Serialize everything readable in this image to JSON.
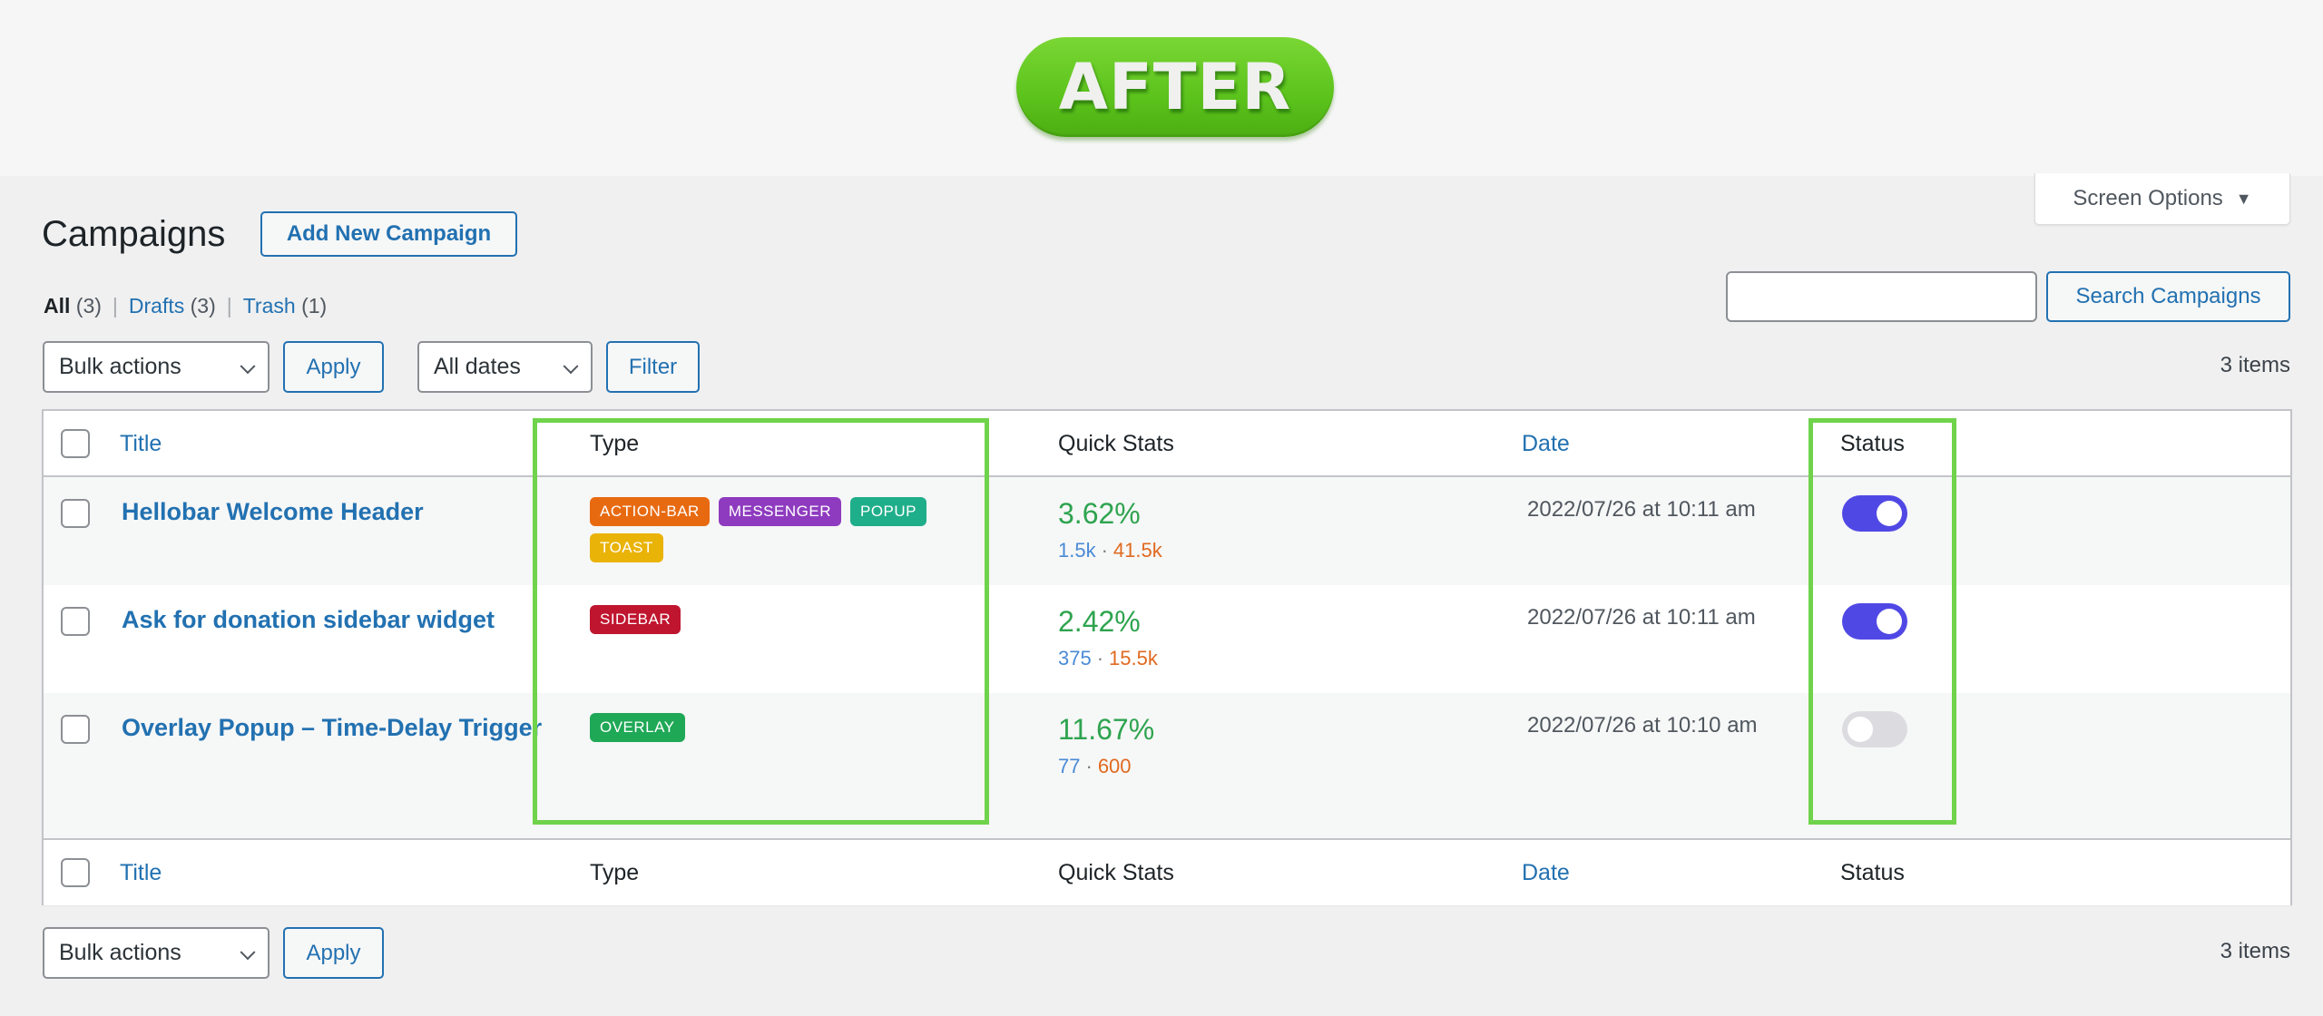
{
  "banner": {
    "label": "AFTER"
  },
  "header": {
    "title": "Campaigns",
    "add_new_label": "Add New Campaign",
    "screen_options_label": "Screen Options"
  },
  "views": {
    "all": {
      "label": "All",
      "count": "(3)"
    },
    "drafts": {
      "label": "Drafts",
      "count": "(3)"
    },
    "trash": {
      "label": "Trash",
      "count": "(1)"
    },
    "separator": "|"
  },
  "search": {
    "value": "",
    "placeholder": "",
    "button_label": "Search Campaigns"
  },
  "toolbar_top": {
    "bulk_actions": "Bulk actions",
    "apply_label": "Apply",
    "dates": "All dates",
    "filter_label": "Filter",
    "items_count": "3 items"
  },
  "toolbar_bottom": {
    "bulk_actions": "Bulk actions",
    "apply_label": "Apply",
    "items_count": "3 items"
  },
  "table": {
    "columns": {
      "title": "Title",
      "type": "Type",
      "quick_stats": "Quick Stats",
      "date": "Date",
      "status": "Status"
    },
    "rows": [
      {
        "title": "Hellobar Welcome Header",
        "types": [
          {
            "label": "ACTION-BAR",
            "color": "#e86a10"
          },
          {
            "label": "MESSENGER",
            "color": "#8e3bbf"
          },
          {
            "label": "POPUP",
            "color": "#1fae8a"
          },
          {
            "label": "TOAST",
            "color": "#eab308"
          }
        ],
        "rate": "3.62%",
        "stat_a": "1.5k",
        "stat_sep": "·",
        "stat_b": "41.5k",
        "date": "2022/07/26 at 10:11 am",
        "active": true
      },
      {
        "title": "Ask for donation sidebar widget",
        "types": [
          {
            "label": "SIDEBAR",
            "color": "#c0152f"
          }
        ],
        "rate": "2.42%",
        "stat_a": "375",
        "stat_sep": "·",
        "stat_b": "15.5k",
        "date": "2022/07/26 at 10:11 am",
        "active": true
      },
      {
        "title": "Overlay Popup – Time-Delay Trigger",
        "types": [
          {
            "label": "OVERLAY",
            "color": "#1fa856"
          }
        ],
        "rate": "11.67%",
        "stat_a": "77",
        "stat_sep": "·",
        "stat_b": "600",
        "date": "2022/07/26 at 10:10 am",
        "active": false
      }
    ]
  },
  "colors": {
    "accent": "#2271b1",
    "toggle_on": "#5048e5",
    "toggle_off": "#dcdce0",
    "highlight": "#6fd34b",
    "rate": "#2ea44f"
  }
}
